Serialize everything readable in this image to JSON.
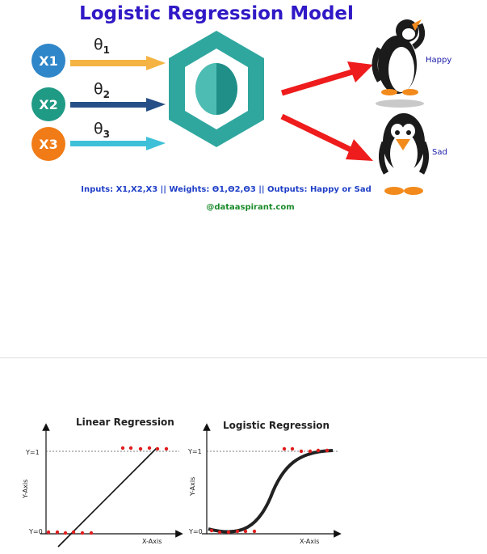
{
  "title": "Logistic Regression Model",
  "inputs": [
    {
      "label": "X1",
      "color": "#2f86c8"
    },
    {
      "label": "X2",
      "color": "#1f9a84"
    },
    {
      "label": "X3",
      "color": "#f07b17"
    }
  ],
  "weights": [
    {
      "symbol": "θ",
      "index": "1",
      "color": "#f4b343"
    },
    {
      "symbol": "θ",
      "index": "2",
      "color": "#254f86"
    },
    {
      "symbol": "θ",
      "index": "3",
      "color": "#3ec0d8"
    }
  ],
  "outputs": {
    "happy": "Happy",
    "sad": "Sad",
    "arrow_color": "#ee1c1c"
  },
  "model_colors": {
    "outer": "#2fa79f",
    "inner": "#1f8f88"
  },
  "caption": "Inputs: X1,X2,X3 || Weights: Θ1,Θ2,Θ3 || Outputs: Happy or Sad",
  "handle": "@dataaspirant.com",
  "plots": {
    "linear": {
      "title": "Linear Regression",
      "y1": "Y=1",
      "y0": "Y=0",
      "ylabel": "Y-Axis",
      "xlabel": "X-Axis"
    },
    "logistic": {
      "title": "Logistic Regression",
      "y1": "Y=1",
      "y0": "Y=0",
      "ylabel": "Y-Axis",
      "xlabel": "X-Axis"
    }
  }
}
